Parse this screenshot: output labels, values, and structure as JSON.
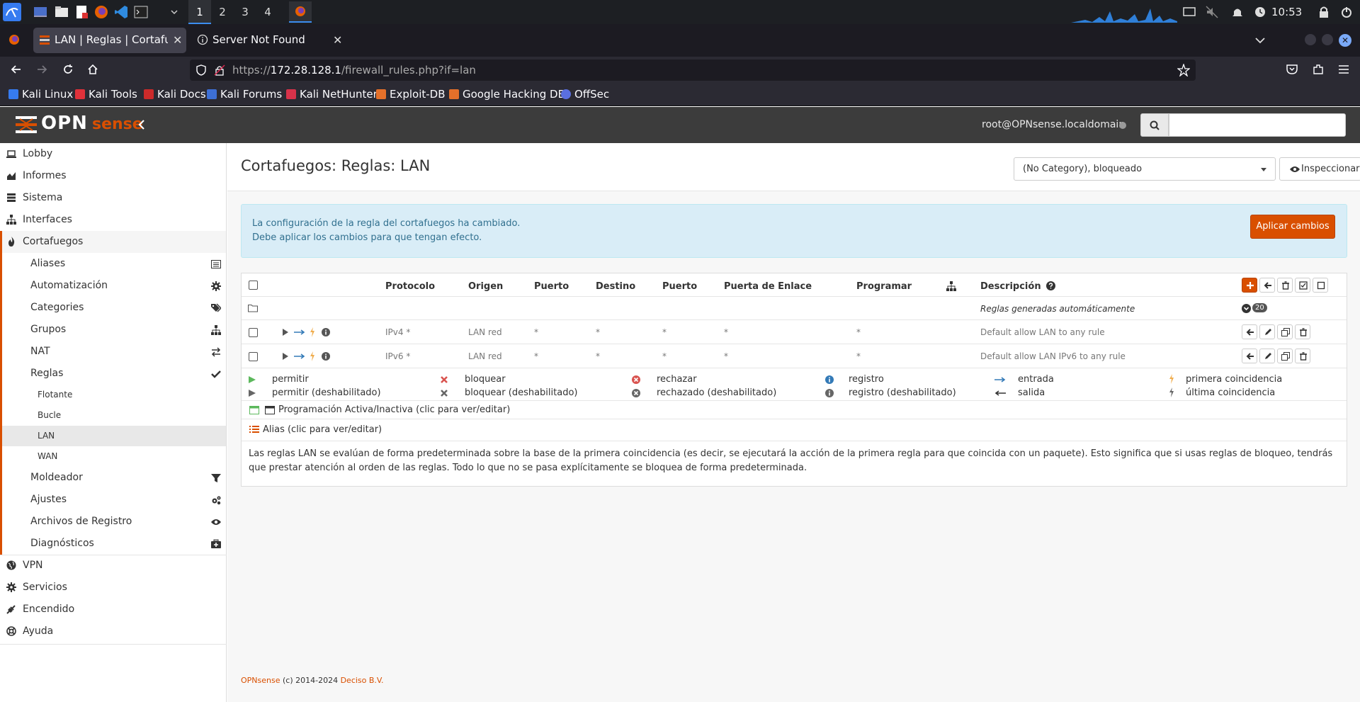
{
  "taskbar": {
    "workspaces": [
      "1",
      "2",
      "3",
      "4"
    ],
    "clock": "10:53"
  },
  "browser": {
    "tabs": [
      {
        "title": "LAN | Reglas | Cortafuegos"
      },
      {
        "title": "Server Not Found"
      }
    ],
    "url": {
      "prefix": "https://",
      "host": "172.28.128.1",
      "path": "/firewall_rules.php?if=lan"
    },
    "bookmarks": [
      "Kali Linux",
      "Kali Tools",
      "Kali Docs",
      "Kali Forums",
      "Kali NetHunter",
      "Exploit-DB",
      "Google Hacking DB",
      "OffSec"
    ]
  },
  "header": {
    "logo_main": "OPN",
    "logo_sub": "sense",
    "user": "root@OPNsense.localdomain"
  },
  "sidebar": {
    "top_items": [
      "Lobby",
      "Informes",
      "Sistema",
      "Interfaces",
      "Cortafuegos"
    ],
    "firewall_items": [
      "Aliases",
      "Automatización",
      "Categories",
      "Grupos",
      "NAT",
      "Reglas"
    ],
    "rules_items": [
      "Flotante",
      "Bucle",
      "LAN",
      "WAN"
    ],
    "firewall_items_2": [
      "Moldeador",
      "Ajustes",
      "Archivos de Registro",
      "Diagnósticos"
    ],
    "bottom_items": [
      "VPN",
      "Servicios",
      "Encendido",
      "Ayuda"
    ]
  },
  "page": {
    "title": "Cortafuegos: Reglas: LAN",
    "category_select": "(No Category), bloqueado",
    "inspect_button": "Inspeccionar"
  },
  "alert": {
    "line1": "La configuración de la regla del cortafuegos ha cambiado.",
    "line2": "Debe aplicar los cambios para que tengan efecto.",
    "apply_button": "Aplicar cambios"
  },
  "rules": {
    "headers": {
      "protocol": "Protocolo",
      "source": "Origen",
      "port1": "Puerto",
      "destination": "Destino",
      "port2": "Puerto",
      "gateway": "Puerta de Enlace",
      "schedule": "Programar",
      "description": "Descripción"
    },
    "auto_rules_label": "Reglas generadas automáticamente",
    "auto_rules_count": "20",
    "rows": [
      {
        "protocol": "IPv4 *",
        "source": "LAN red",
        "port1": "*",
        "destination": "*",
        "port2": "*",
        "gateway": "*",
        "schedule": "*",
        "description": "Default allow LAN to any rule"
      },
      {
        "protocol": "IPv6 *",
        "source": "LAN red",
        "port1": "*",
        "destination": "*",
        "port2": "*",
        "gateway": "*",
        "schedule": "*",
        "description": "Default allow LAN IPv6 to any rule"
      }
    ]
  },
  "legend": {
    "pass": "permitir",
    "pass_disabled": "permitir (deshabilitado)",
    "block": "bloquear",
    "block_disabled": "bloquear (deshabilitado)",
    "reject": "rechazar",
    "reject_disabled": "rechazado (deshabilitado)",
    "log": "registro",
    "log_disabled": "registro (deshabilitado)",
    "in": "entrada",
    "out": "salida",
    "first_match": "primera coincidencia",
    "last_match": "última coincidencia",
    "schedule": "Programación Activa/Inactiva (clic para ver/editar)",
    "alias": "Alias (clic para ver/editar)",
    "note": "Las reglas LAN se evalúan de forma predeterminada sobre la base de la primera coincidencia (es decir, se ejecutará la acción de la primera regla para que coincida con un paquete). Esto significa que si usas reglas de bloqueo, tendrás que prestar atención al orden de las reglas. Todo lo que no se pasa explícitamente se bloquea de forma predeterminada."
  },
  "footer": {
    "brand": "OPNsense",
    "copyright": " (c) 2014-2024 ",
    "company": "Deciso B.V."
  },
  "colors": {
    "accent": "#d94f00",
    "header_bg": "#3c3c3c",
    "alert_bg": "#d9edf7",
    "pass_green": "#5cb85c",
    "block_red": "#d9534f",
    "direction_blue": "#337ab7",
    "match_yellow": "#f0ad4e"
  }
}
